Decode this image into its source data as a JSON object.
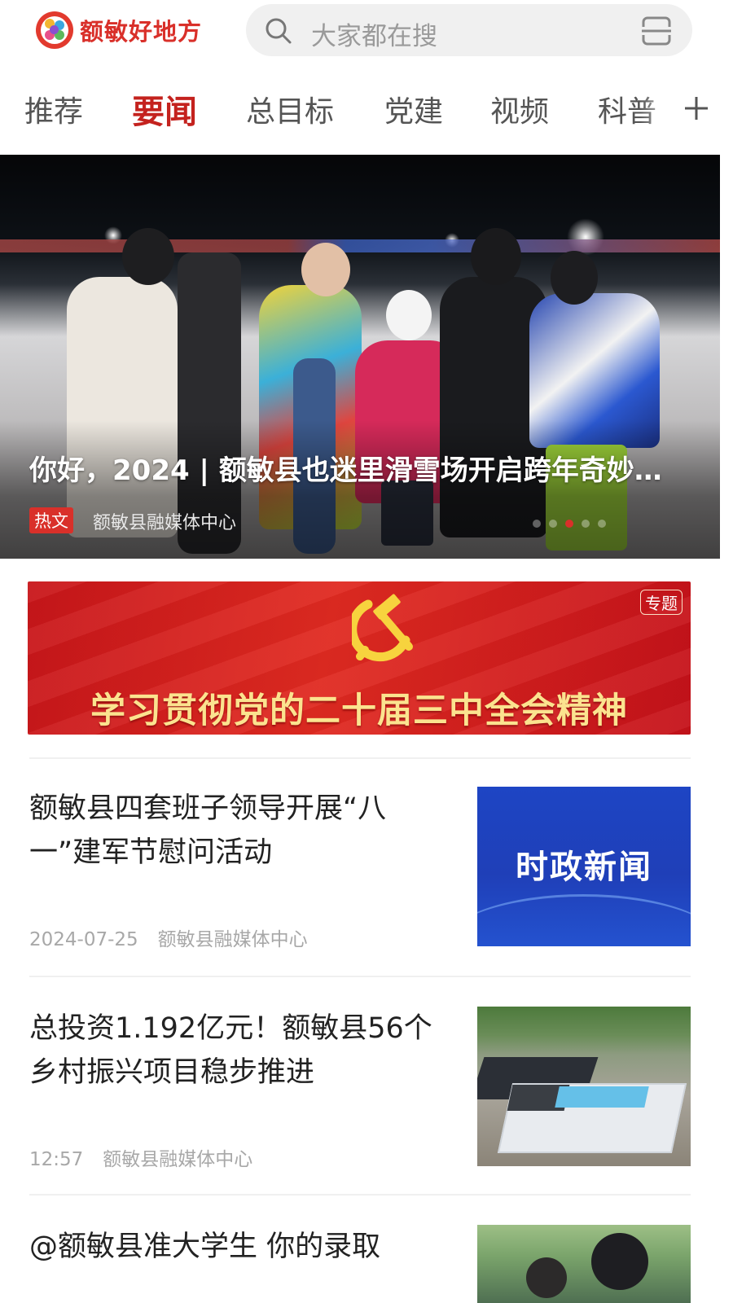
{
  "header": {
    "app_name": "额敏好地方",
    "search_placeholder": "大家都在搜",
    "logo_icon": "app-logo",
    "search_icon": "search-icon",
    "scan_icon": "scan-icon"
  },
  "tabs": [
    {
      "label": "推荐",
      "active": false
    },
    {
      "label": "要闻",
      "active": true
    },
    {
      "label": "总目标",
      "active": false
    },
    {
      "label": "党建",
      "active": false
    },
    {
      "label": "视频",
      "active": false
    },
    {
      "label": "科普",
      "active": false
    }
  ],
  "hero": {
    "title": "你好，2024 | 额敏县也迷里滑雪场开启跨年奇妙…",
    "badge": "热文",
    "source": "额敏县融媒体中心",
    "slide_count": 5,
    "active_slide": 3
  },
  "banner": {
    "tag": "专题",
    "text": "学习贯彻党的二十届三中全会精神"
  },
  "news": [
    {
      "title": "额敏县四套班子领导开展“八一”建军节慰问活动",
      "date": "2024-07-25",
      "source": "额敏县融媒体中心",
      "thumb_text": "时政新闻"
    },
    {
      "title": "总投资1.192亿元！额敏县56个乡村振兴项目稳步推进",
      "date": "12:57",
      "source": "额敏县融媒体中心"
    },
    {
      "title": "@额敏县准大学生  你的录取"
    }
  ],
  "colors": {
    "brand_red": "#d9302a",
    "active_tab": "#c4221e",
    "banner_text": "#fbe38f"
  }
}
